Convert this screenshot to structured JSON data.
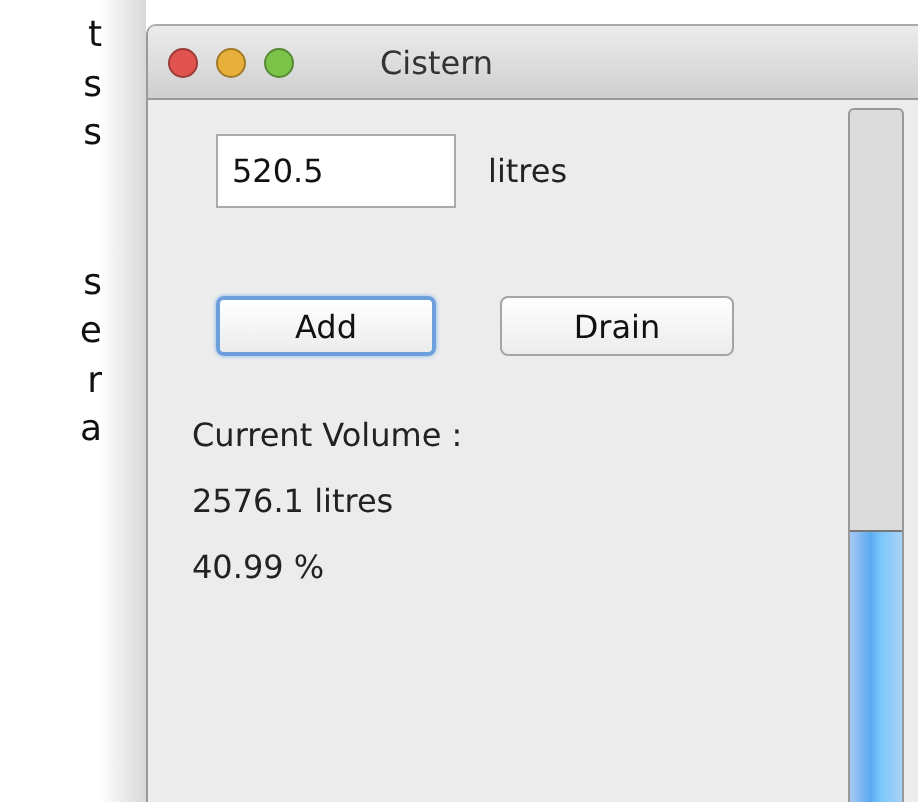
{
  "background_text": {
    "upper_lines": [
      "t",
      "s",
      "s"
    ],
    "lower_lines": [
      "s",
      "e",
      "r",
      "a"
    ]
  },
  "window": {
    "title": "Cistern"
  },
  "amount_field": {
    "value": "520.5"
  },
  "unit_label": "litres",
  "buttons": [
    {
      "label": "Add",
      "default": true
    },
    {
      "label": "Drain",
      "default": false
    }
  ],
  "volume_caption": "Current Volume :",
  "volume_value": "2576.1 litres",
  "volume_percent": "40.99 %",
  "level_bar": {
    "level": 0.41
  }
}
